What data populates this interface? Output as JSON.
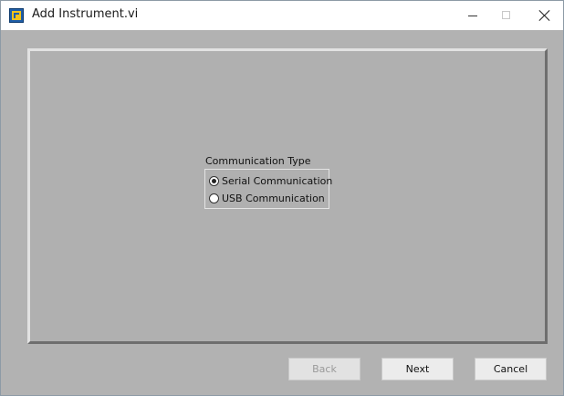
{
  "window": {
    "title": "Add Instrument.vi",
    "app_icon": "labview-vi-icon",
    "controls": {
      "minimize_icon": "minimize-icon",
      "maximize_icon": "maximize-icon",
      "close_icon": "close-icon"
    }
  },
  "panel": {
    "group_label": "Communication Type",
    "options": [
      {
        "label": "Serial Communication",
        "selected": true
      },
      {
        "label": "USB Communication",
        "selected": false
      }
    ]
  },
  "buttons": {
    "back_label": "Back",
    "back_enabled": false,
    "next_label": "Next",
    "cancel_label": "Cancel"
  },
  "colors": {
    "panel_background": "#b0b0b0",
    "titlebar_background": "#ffffff"
  }
}
